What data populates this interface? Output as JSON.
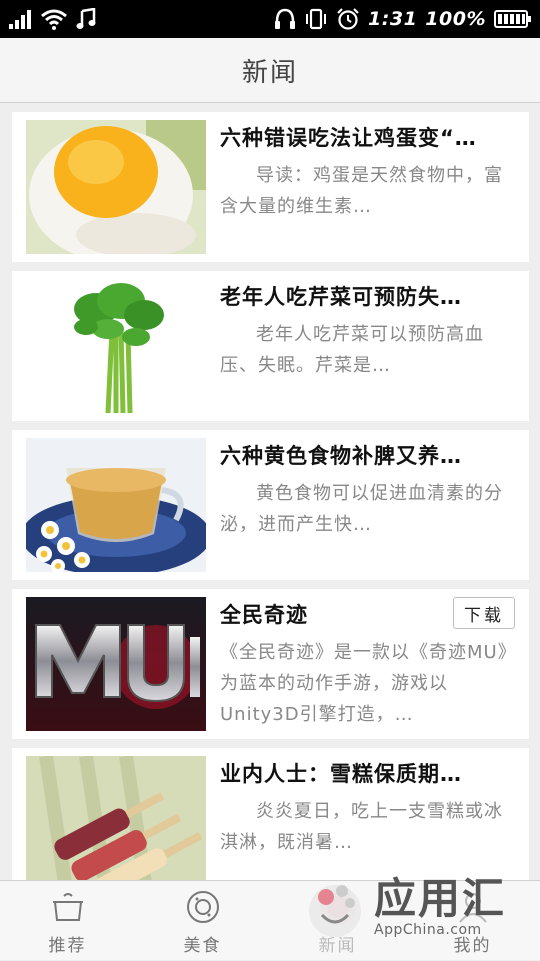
{
  "status_bar": {
    "time": "1:31",
    "battery": "100%",
    "icons": [
      "signal-icon",
      "wifi-icon",
      "music-note-icon",
      "headphone-icon",
      "vibrate-icon",
      "alarm-icon",
      "battery-icon"
    ]
  },
  "header": {
    "title": "新闻"
  },
  "news": [
    {
      "title": "六种错误吃法让鸡蛋变“…",
      "summary": "导读：鸡蛋是天然食物中，富含大量的维生素…"
    },
    {
      "title": "老年人吃芹菜可预防失…",
      "summary": "老年人吃芹菜可以预防高血压、失眠。芹菜是…"
    },
    {
      "title": "六种黄色食物补脾又养…",
      "summary": "黄色食物可以促进血清素的分泌，进而产生快…"
    },
    {
      "title": "全民奇迹",
      "summary": "《全民奇迹》是一款以《奇迹MU》为蓝本的动作手游，游戏以Unity3D引擎打造，…",
      "button": "下载"
    },
    {
      "title": "业内人士：雪糕保质期…",
      "summary": "炎炎夏日，吃上一支雪糕或冰淇淋，既消暑…"
    }
  ],
  "tabs": [
    {
      "label": "推荐",
      "icon": "pot-icon"
    },
    {
      "label": "美食",
      "icon": "plate-icon"
    },
    {
      "label": "新闻",
      "icon": "news-icon"
    },
    {
      "label": "我的",
      "icon": "user-icon"
    }
  ],
  "watermark": {
    "brand": "应用汇",
    "domain": "AppChina.com"
  },
  "colors": {
    "status_bar": "#000000",
    "background": "#eeeeee",
    "card": "#ffffff",
    "title": "#111111",
    "summary": "#888888"
  }
}
